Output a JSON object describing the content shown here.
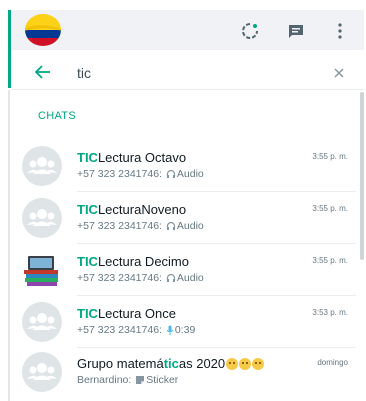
{
  "header": {
    "avatar_icon": "colombia-flag-avatar",
    "status_icon": "status-icon",
    "new_chat_icon": "new-chat-icon",
    "menu_icon": "menu-dots-icon",
    "accent": "#00a884",
    "bg": "#f0f2f5"
  },
  "search": {
    "value": "tic",
    "back_icon": "back-arrow-icon",
    "clear_icon": "close-icon"
  },
  "section": {
    "label": "CHATS"
  },
  "chats": [
    {
      "highlight": "TIC",
      "rest": "Lectura Octavo",
      "sender": "+57 323 2341746: ",
      "media_icon": "headphones-icon",
      "media": "Audio",
      "time": "3:55 p. m.",
      "avatar": "group-avatar"
    },
    {
      "highlight": "TIC",
      "rest": "LecturaNoveno",
      "sender": "+57 323 2341746: ",
      "media_icon": "headphones-icon",
      "media": "Audio",
      "time": "3:55 p. m.",
      "avatar": "group-avatar"
    },
    {
      "highlight": "TIC",
      "rest": "Lectura Decimo",
      "sender": "+57 323 2341746: ",
      "media_icon": "headphones-icon",
      "media": "Audio",
      "time": "3:55 p. m.",
      "avatar": "books-avatar"
    },
    {
      "highlight": "TIC",
      "rest": "Lectura Once",
      "sender": "+57 323 2341746: ",
      "media_icon": "microphone-icon",
      "media": "0:39",
      "time": "3:53 p. m.",
      "avatar": "group-avatar"
    },
    {
      "pre": "Grupo matemá",
      "highlight": "tic",
      "rest": "as 2020",
      "sender": "Bernardino: ",
      "media_icon": "sticker-icon",
      "media": "Sticker",
      "time": "domingo",
      "avatar": "group-avatar"
    }
  ]
}
